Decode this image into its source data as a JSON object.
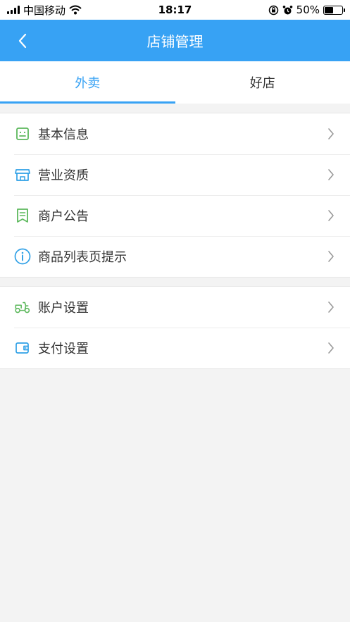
{
  "status_bar": {
    "carrier": "中国移动",
    "time": "18:17",
    "battery_text": "50%",
    "battery_level": 0.5
  },
  "nav": {
    "title": "店铺管理"
  },
  "tabs": [
    {
      "label": "外卖",
      "active": true
    },
    {
      "label": "好店",
      "active": false
    }
  ],
  "menu_group_1": [
    {
      "label": "基本信息",
      "icon": "id-card-icon"
    },
    {
      "label": "营业资质",
      "icon": "storefront-icon"
    },
    {
      "label": "商户公告",
      "icon": "notice-icon"
    },
    {
      "label": "商品列表页提示",
      "icon": "info-icon"
    }
  ],
  "menu_group_2": [
    {
      "label": "账户设置",
      "icon": "scooter-icon"
    },
    {
      "label": "支付设置",
      "icon": "wallet-icon"
    }
  ],
  "colors": {
    "accent": "#37a2f4",
    "green_icon": "#5cb85c",
    "blue_icon": "#2fa0e6"
  }
}
